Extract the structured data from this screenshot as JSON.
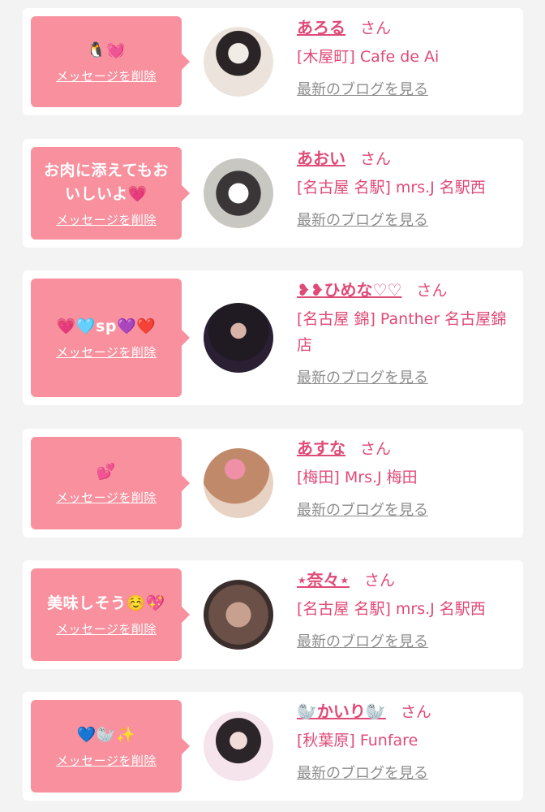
{
  "delete_label": "メッセージを削除",
  "blog_label": "最新のブログを見る",
  "san_label": "さん",
  "colors": {
    "background": "#f3f3f3",
    "card": "#ffffff",
    "bubble": "#f8909e",
    "accent_pink": "#e04a77",
    "link_gray": "#8c8c8c"
  },
  "messages": [
    {
      "message": "🐧💓",
      "name": "あろる",
      "shop": "[木屋町] Cafe de Ai"
    },
    {
      "message": "お肉に添えてもおいしいよ💗",
      "name": "あおい",
      "shop": "[名古屋 名駅] mrs.J 名駅西"
    },
    {
      "message": "💗🩵sp💜❤️",
      "name": "❥❥ひめな♡♡",
      "shop": "[名古屋 錦] Panther 名古屋錦店"
    },
    {
      "message": "💕",
      "name": "あすな",
      "shop": "[梅田] Mrs.J 梅田"
    },
    {
      "message": "美味しそう☺️💖",
      "name": "⋆奈々⋆",
      "shop": "[名古屋 名駅] mrs.J 名駅西"
    },
    {
      "message": "💙🦭✨",
      "name": "🦭かいり🦭",
      "shop": "[秋葉原] Funfare"
    }
  ]
}
